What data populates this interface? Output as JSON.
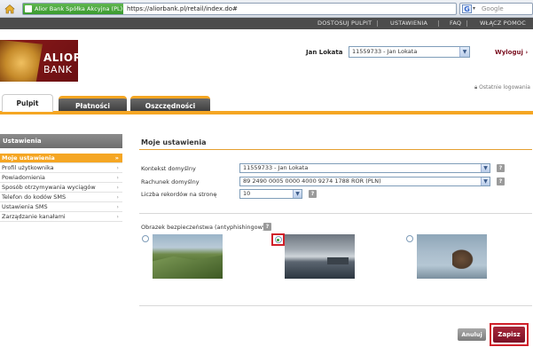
{
  "browser": {
    "site_identity": "Alior Bank Spółka Akcyjna (PL)",
    "url": "https://aliorbank.pl/retail/index.do#",
    "search_placeholder": "Google"
  },
  "topnav": {
    "items": [
      "DOSTOSUJ PULPIT",
      "USTAWIENIA",
      "FAQ",
      "WŁĄCZ POMOC"
    ]
  },
  "header": {
    "logo_line1": "ALIOR",
    "logo_line2": "BANK",
    "user_name": "Jan Lokata",
    "account_select": "11559733 - Jan Lokata",
    "logout": "Wyloguj",
    "last_login": "Ostatnie logowania"
  },
  "tabs": [
    "Pulpit",
    "Płatności",
    "Oszczędności"
  ],
  "sidebar": {
    "header": "Ustawienia",
    "items": [
      {
        "label": "Moje ustawienia",
        "active": true
      },
      {
        "label": "Profil użytkownika"
      },
      {
        "label": "Powiadomienia"
      },
      {
        "label": "Sposób otrzymywania wyciągów"
      },
      {
        "label": "Telefon do kodów SMS"
      },
      {
        "label": "Ustawienia SMS"
      },
      {
        "label": "Zarządzanie kanałami"
      }
    ]
  },
  "main": {
    "title": "Moje ustawienia",
    "fields": [
      {
        "label": "Kontekst domyślny",
        "value": "11559733 - Jan Lokata"
      },
      {
        "label": "Rachunek domyślny",
        "value": "89 2490 0005 0000 4000 9274 1788 ROR (PLN)"
      },
      {
        "label": "Liczba rekordów na stronę",
        "value": "10"
      }
    ],
    "security_image_label": "Obrazek bezpieczeństwa (antyphishingowy)",
    "help": "?",
    "cancel": "Anuluj",
    "save": "Zapisz"
  },
  "colors": {
    "accent": "#f5a623",
    "brand": "#7a1026",
    "highlight": "#d0202a"
  }
}
